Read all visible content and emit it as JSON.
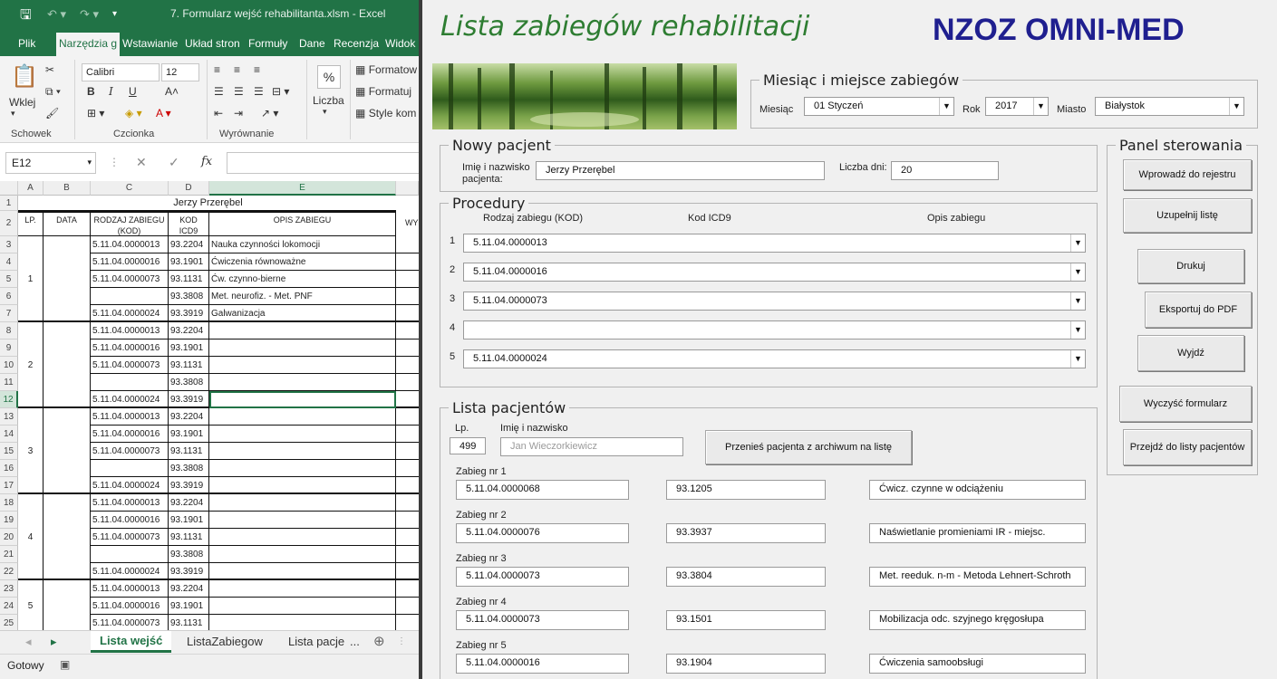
{
  "excel": {
    "window_title": "7. Formularz wejść rehabilitanta.xlsm  -  Excel",
    "ribbon_tabs": [
      "Plik",
      "Narzędzia g",
      "Wstawianie",
      "Układ stron",
      "Formuły",
      "Dane",
      "Recenzja",
      "Widok"
    ],
    "ribbon": {
      "paste_label": "Wklej",
      "font_name": "Calibri",
      "font_size": "12",
      "bold": "B",
      "italic": "I",
      "underline": "U",
      "group_clipboard": "Schowek",
      "group_font": "Czcionka",
      "group_alignment": "Wyrównanie",
      "number_label": "Liczba",
      "percent": "%",
      "styles": [
        "Formatow",
        "Formatuj",
        "Style kom"
      ]
    },
    "name_box": "E12",
    "fx": "fx",
    "column_headers": [
      "A",
      "B",
      "C",
      "D",
      "E"
    ],
    "merged_title": "Jerzy Przerębel",
    "table_headers": {
      "lp": "LP.",
      "data": "DATA",
      "rodzaj": "RODZAJ ZABIEGU (KOD)",
      "kod": "KOD ICD9",
      "opis": "OPIS ZABIEGU",
      "extra": "WY"
    },
    "row_numbers": [
      "1",
      "2",
      "3",
      "4",
      "5",
      "6",
      "7",
      "8",
      "9",
      "10",
      "11",
      "12",
      "13",
      "14",
      "15",
      "16",
      "17",
      "18",
      "19",
      "20",
      "21",
      "22",
      "23",
      "24",
      "25"
    ],
    "rows": [
      {
        "c": "5.11.04.0000013",
        "d": "93.2204",
        "e": "Nauka czynności lokomocji"
      },
      {
        "c": "5.11.04.0000016",
        "d": "93.1901",
        "e": "Ćwiczenia równoważne"
      },
      {
        "c": "5.11.04.0000073",
        "d": "93.1131",
        "e": "Ćw. czynno-bierne"
      },
      {
        "c": "",
        "d": "93.3808",
        "e": "Met. neurofiz. - Met. PNF"
      },
      {
        "c": "5.11.04.0000024",
        "d": "93.3919",
        "e": "Galwanizacja"
      },
      {
        "c": "5.11.04.0000013",
        "d": "93.2204",
        "e": ""
      },
      {
        "c": "5.11.04.0000016",
        "d": "93.1901",
        "e": ""
      },
      {
        "c": "5.11.04.0000073",
        "d": "93.1131",
        "e": ""
      },
      {
        "c": "",
        "d": "93.3808",
        "e": ""
      },
      {
        "c": "5.11.04.0000024",
        "d": "93.3919",
        "e": ""
      },
      {
        "c": "5.11.04.0000013",
        "d": "93.2204",
        "e": ""
      },
      {
        "c": "5.11.04.0000016",
        "d": "93.1901",
        "e": ""
      },
      {
        "c": "5.11.04.0000073",
        "d": "93.1131",
        "e": ""
      },
      {
        "c": "",
        "d": "93.3808",
        "e": ""
      },
      {
        "c": "5.11.04.0000024",
        "d": "93.3919",
        "e": ""
      },
      {
        "c": "5.11.04.0000013",
        "d": "93.2204",
        "e": ""
      },
      {
        "c": "5.11.04.0000016",
        "d": "93.1901",
        "e": ""
      },
      {
        "c": "5.11.04.0000073",
        "d": "93.1131",
        "e": ""
      },
      {
        "c": "",
        "d": "93.3808",
        "e": ""
      },
      {
        "c": "5.11.04.0000024",
        "d": "93.3919",
        "e": ""
      },
      {
        "c": "5.11.04.0000013",
        "d": "93.2204",
        "e": ""
      },
      {
        "c": "5.11.04.0000016",
        "d": "93.1901",
        "e": ""
      },
      {
        "c": "5.11.04.0000073",
        "d": "93.1131",
        "e": ""
      }
    ],
    "lp_groups": [
      "1",
      "2",
      "3",
      "4",
      "5"
    ],
    "sheet_tabs": [
      "Lista wejść",
      "ListaZabiegow",
      "Lista pacje",
      "..."
    ],
    "status": "Gotowy",
    "accent": "#217346"
  },
  "form": {
    "title": "Lista zabiegów rehabilitacji",
    "brand": "NZOZ OMNI-MED",
    "brand_color": "#1f1f8f",
    "title_color": "#2e7d32",
    "period": {
      "frame_label": "Miesiąc i miejsce zabiegów",
      "month_label": "Miesiąc",
      "month_value": "01 Styczeń",
      "year_label": "Rok",
      "year_value": "2017",
      "city_label": "Miasto",
      "city_value": "Białystok"
    },
    "patient": {
      "frame_label": "Nowy pacjent",
      "name_label": "Imię i nazwisko pacjenta:",
      "name_value": "Jerzy Przerębel",
      "days_label": "Liczba dni:",
      "days_value": "20"
    },
    "procedures": {
      "frame_label": "Procedury",
      "col_rodzaj": "Rodzaj zabiegu (KOD)",
      "col_kod": "Kod ICD9",
      "col_opis": "Opis zabiegu",
      "items": [
        {
          "n": "1",
          "value": "5.11.04.0000013"
        },
        {
          "n": "2",
          "value": "5.11.04.0000016"
        },
        {
          "n": "3",
          "value": "5.11.04.0000073"
        },
        {
          "n": "4",
          "value": ""
        },
        {
          "n": "5",
          "value": "5.11.04.0000024"
        }
      ]
    },
    "patients_list": {
      "frame_label": "Lista pacjentów",
      "lp_label": "Lp.",
      "lp_value": "499",
      "name_label": "Imię i nazwisko",
      "name_value": "Jan Wieczorkiewicz",
      "move_button": "Przenieś pacjenta z archiwum na listę",
      "treatments": [
        {
          "label": "Zabieg nr 1",
          "code": "5.11.04.0000068",
          "icd": "93.1205",
          "desc": "Ćwicz. czynne w odciążeniu"
        },
        {
          "label": "Zabieg nr 2",
          "code": "5.11.04.0000076",
          "icd": "93.3937",
          "desc": "Naświetlanie promieniami IR - miejsc."
        },
        {
          "label": "Zabieg nr 3",
          "code": "5.11.04.0000073",
          "icd": "93.3804",
          "desc": "Met. reeduk. n-m - Metoda Lehnert-Schroth"
        },
        {
          "label": "Zabieg nr 4",
          "code": "5.11.04.0000073",
          "icd": "93.1501",
          "desc": "Mobilizacja odc. szyjnego kręgosłupa"
        },
        {
          "label": "Zabieg nr 5",
          "code": "5.11.04.0000016",
          "icd": "93.1904",
          "desc": "Ćwiczenia samoobsługi"
        }
      ]
    },
    "panel": {
      "frame_label": "Panel sterowania",
      "btn_register": "Wprowadź do rejestru",
      "btn_fill": "Uzupełnij listę",
      "btn_print": "Drukuj",
      "btn_pdf": "Eksportuj do PDF",
      "btn_exit": "Wyjdź",
      "btn_clear": "Wyczyść formularz",
      "btn_goto": "Przejdź do listy pacjentów"
    }
  }
}
